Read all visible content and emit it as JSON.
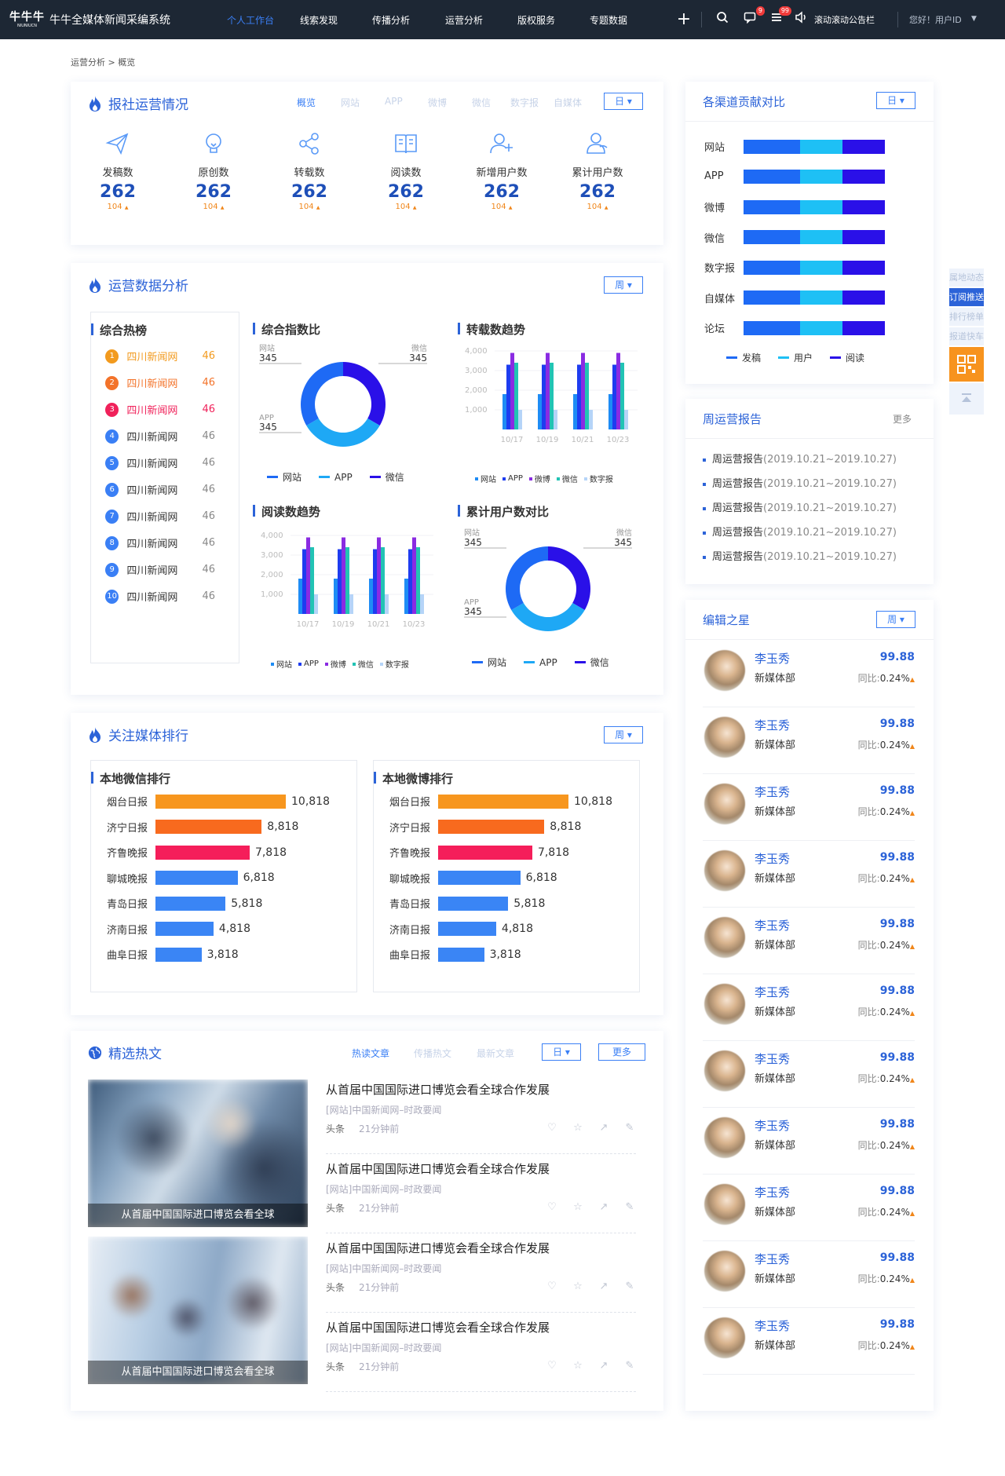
{
  "app": {
    "title": "牛牛全媒体新闻采编系统",
    "logo_text": "牛牛牛",
    "logo_sub": "NIUNIUCN"
  },
  "nav": [
    "个人工作台",
    "线索发现",
    "传播分析",
    "运营分析",
    "版权服务",
    "专题数据"
  ],
  "topbar": {
    "plus": "+",
    "msg_badge": "9",
    "list_badge": "99",
    "announce": "滚动滚动公告栏",
    "greeting": "您好！用户ID"
  },
  "breadcrumb": "运营分析 > 概览",
  "ops": {
    "title": "报社运营情况",
    "tabs": [
      "概览",
      "网站",
      "APP",
      "微博",
      "微信",
      "数字报",
      "自媒体"
    ],
    "period": "日",
    "stats": [
      {
        "label": "发稿数",
        "value": "262",
        "sub": "104",
        "icon": "send-icon"
      },
      {
        "label": "原创数",
        "value": "262",
        "sub": "104",
        "icon": "bulb-icon"
      },
      {
        "label": "转载数",
        "value": "262",
        "sub": "104",
        "icon": "share-icon"
      },
      {
        "label": "阅读数",
        "value": "262",
        "sub": "104",
        "icon": "book-icon"
      },
      {
        "label": "新增用户数",
        "value": "262",
        "sub": "104",
        "icon": "user-add-icon"
      },
      {
        "label": "累计用户数",
        "value": "262",
        "sub": "104",
        "icon": "users-icon"
      }
    ],
    "up_arrow": "▲"
  },
  "analysis": {
    "title": "运营数据分析",
    "period": "周",
    "hot_title": "综合热榜",
    "hot": [
      {
        "rank": "1",
        "name": "四川新闻网",
        "value": "46",
        "color": "#f29a1e"
      },
      {
        "rank": "2",
        "name": "四川新闻网",
        "value": "46",
        "color": "#f3732a"
      },
      {
        "rank": "3",
        "name": "四川新闻网",
        "value": "46",
        "color": "#f0215a"
      },
      {
        "rank": "4",
        "name": "四川新闻网",
        "value": "46",
        "color": "#3a7ff5"
      },
      {
        "rank": "5",
        "name": "四川新闻网",
        "value": "46",
        "color": "#3a7ff5"
      },
      {
        "rank": "6",
        "name": "四川新闻网",
        "value": "46",
        "color": "#3a7ff5"
      },
      {
        "rank": "7",
        "name": "四川新闻网",
        "value": "46",
        "color": "#3a7ff5"
      },
      {
        "rank": "8",
        "name": "四川新闻网",
        "value": "46",
        "color": "#3a7ff5"
      },
      {
        "rank": "9",
        "name": "四川新闻网",
        "value": "46",
        "color": "#3a7ff5"
      },
      {
        "rank": "10",
        "name": "四川新闻网",
        "value": "46",
        "color": "#3a7ff5"
      }
    ],
    "donut1_title": "综合指数比",
    "bar1_title": "转载数趋势",
    "bar2_title": "阅读数趋势",
    "donut2_title": "累计用户数对比",
    "donut_legend": [
      "网站",
      "APP",
      "微信"
    ],
    "bar_legend": [
      "网站",
      "APP",
      "微博",
      "微信",
      "数字报"
    ]
  },
  "chart_data": [
    {
      "type": "pie",
      "title": "综合指数比",
      "labels": [
        "网站",
        "APP",
        "微信"
      ],
      "values": [
        345,
        345,
        345
      ],
      "colors": [
        "#1e6af5",
        "#1ea8f5",
        "#2a10e8"
      ]
    },
    {
      "type": "bar",
      "title": "转载数趋势",
      "categories": [
        "10/17",
        "10/19",
        "10/21",
        "10/23"
      ],
      "yticks": [
        "4,000",
        "3,000",
        "2,000",
        "1,000"
      ],
      "ylim": [
        0,
        4000
      ],
      "series": [
        {
          "name": "网站",
          "color": "#1e8cf5",
          "values": [
            1800,
            1800,
            1800,
            1800
          ]
        },
        {
          "name": "APP",
          "color": "#1e3cf0",
          "values": [
            3300,
            3300,
            3300,
            3300
          ]
        },
        {
          "name": "微博",
          "color": "#8a2be2",
          "values": [
            3900,
            3900,
            3900,
            3900
          ]
        },
        {
          "name": "微信",
          "color": "#22c3b4",
          "values": [
            3400,
            3400,
            3400,
            3400
          ]
        },
        {
          "name": "数字报",
          "color": "#b5d4f8",
          "values": [
            1000,
            1000,
            1000,
            1000
          ]
        }
      ]
    },
    {
      "type": "bar",
      "title": "阅读数趋势",
      "categories": [
        "10/17",
        "10/19",
        "10/21",
        "10/23"
      ],
      "yticks": [
        "4,000",
        "3,000",
        "2,000",
        "1,000"
      ],
      "ylim": [
        0,
        4000
      ],
      "series": [
        {
          "name": "网站",
          "color": "#1e8cf5",
          "values": [
            1800,
            1800,
            1800,
            1800
          ]
        },
        {
          "name": "APP",
          "color": "#1e3cf0",
          "values": [
            3300,
            3300,
            3300,
            3300
          ]
        },
        {
          "name": "微博",
          "color": "#8a2be2",
          "values": [
            3900,
            3900,
            3900,
            3900
          ]
        },
        {
          "name": "微信",
          "color": "#22c3b4",
          "values": [
            3400,
            3400,
            3400,
            3400
          ]
        },
        {
          "name": "数字报",
          "color": "#b5d4f8",
          "values": [
            1000,
            1000,
            1000,
            1000
          ]
        }
      ]
    },
    {
      "type": "pie",
      "title": "累计用户数对比",
      "labels": [
        "网站",
        "APP",
        "微信"
      ],
      "values": [
        345,
        345,
        345
      ],
      "colors": [
        "#1e6af5",
        "#1ea8f5",
        "#2a10e8"
      ]
    },
    {
      "type": "bar",
      "title": "本地微信排行",
      "categories": [
        "烟台日报",
        "济宁日报",
        "齐鲁晚报",
        "聊城晚报",
        "青岛日报",
        "济南日报",
        "曲阜日报"
      ],
      "values": [
        10818,
        8818,
        7818,
        6818,
        5818,
        4818,
        3818
      ],
      "labels": [
        "10,818",
        "8,818",
        "7,818",
        "6,818",
        "5,818",
        "4,818",
        "3,818"
      ]
    },
    {
      "type": "bar",
      "title": "本地微博排行",
      "categories": [
        "烟台日报",
        "济宁日报",
        "齐鲁晚报",
        "聊城晚报",
        "青岛日报",
        "济南日报",
        "曲阜日报"
      ],
      "values": [
        10818,
        8818,
        7818,
        6818,
        5818,
        4818,
        3818
      ],
      "labels": [
        "10,818",
        "8,818",
        "7,818",
        "6,818",
        "5,818",
        "4,818",
        "3,818"
      ]
    },
    {
      "type": "bar",
      "title": "各渠道贡献对比",
      "categories": [
        "网站",
        "APP",
        "微博",
        "微信",
        "数字报",
        "自媒体",
        "论坛"
      ],
      "series": [
        {
          "name": "发稿",
          "color": "#1e6af5",
          "values": [
            40,
            40,
            40,
            40,
            40,
            40,
            40
          ]
        },
        {
          "name": "用户",
          "color": "#1ec0f5",
          "values": [
            30,
            30,
            30,
            30,
            30,
            30,
            30
          ]
        },
        {
          "name": "阅读",
          "color": "#2a10e8",
          "values": [
            30,
            30,
            30,
            30,
            30,
            30,
            30
          ]
        }
      ]
    }
  ],
  "media": {
    "title": "关注媒体排行",
    "period": "周",
    "wechat_title": "本地微信排行",
    "weibo_title": "本地微博排行",
    "bar_colors": [
      "#f7961e",
      "#f86a1e",
      "#f51e5a",
      "#3a85f5",
      "#3a85f5",
      "#3a85f5",
      "#3a85f5"
    ]
  },
  "hot": {
    "title": "精选热文",
    "tabs": [
      "热读文章",
      "传播热文",
      "最新文章"
    ],
    "period": "日",
    "more": "更多",
    "images": [
      {
        "caption": "从首届中国国际进口博览会看全球"
      },
      {
        "caption": "从首届中国国际进口博览会看全球"
      }
    ],
    "items": [
      {
        "title": "从首届中国国际进口博览会看全球合作发展",
        "source": "[网站]中国新闻网–时政要闻",
        "tag": "头条",
        "time": "21分钟前"
      },
      {
        "title": "从首届中国国际进口博览会看全球合作发展",
        "source": "[网站]中国新闻网–时政要闻",
        "tag": "头条",
        "time": "21分钟前"
      },
      {
        "title": "从首届中国国际进口博览会看全球合作发展",
        "source": "[网站]中国新闻网–时政要闻",
        "tag": "头条",
        "time": "21分钟前"
      },
      {
        "title": "从首届中国国际进口博览会看全球合作发展",
        "source": "[网站]中国新闻网–时政要闻",
        "tag": "头条",
        "time": "21分钟前"
      }
    ]
  },
  "channels": {
    "title": "各渠道贡献对比",
    "period": "日",
    "legend": [
      "发稿",
      "用户",
      "阅读"
    ]
  },
  "weekly": {
    "title": "周运营报告",
    "more": "更多",
    "items": [
      {
        "label": "周运营报告",
        "range": "(2019.10.21~2019.10.27)"
      },
      {
        "label": "周运营报告",
        "range": "(2019.10.21~2019.10.27)"
      },
      {
        "label": "周运营报告",
        "range": "(2019.10.21~2019.10.27)"
      },
      {
        "label": "周运营报告",
        "range": "(2019.10.21~2019.10.27)"
      },
      {
        "label": "周运营报告",
        "range": "(2019.10.21~2019.10.27)"
      }
    ]
  },
  "stars": {
    "title": "编辑之星",
    "period": "周",
    "yoy_label": "同比:",
    "items": [
      {
        "name": "李玉秀",
        "dept": "新媒体部",
        "score": "99.88",
        "yoy": "0.24%"
      },
      {
        "name": "李玉秀",
        "dept": "新媒体部",
        "score": "99.88",
        "yoy": "0.24%"
      },
      {
        "name": "李玉秀",
        "dept": "新媒体部",
        "score": "99.88",
        "yoy": "0.24%"
      },
      {
        "name": "李玉秀",
        "dept": "新媒体部",
        "score": "99.88",
        "yoy": "0.24%"
      },
      {
        "name": "李玉秀",
        "dept": "新媒体部",
        "score": "99.88",
        "yoy": "0.24%"
      },
      {
        "name": "李玉秀",
        "dept": "新媒体部",
        "score": "99.88",
        "yoy": "0.24%"
      },
      {
        "name": "李玉秀",
        "dept": "新媒体部",
        "score": "99.88",
        "yoy": "0.24%"
      },
      {
        "name": "李玉秀",
        "dept": "新媒体部",
        "score": "99.88",
        "yoy": "0.24%"
      },
      {
        "name": "李玉秀",
        "dept": "新媒体部",
        "score": "99.88",
        "yoy": "0.24%"
      },
      {
        "name": "李玉秀",
        "dept": "新媒体部",
        "score": "99.88",
        "yoy": "0.24%"
      },
      {
        "name": "李玉秀",
        "dept": "新媒体部",
        "score": "99.88",
        "yoy": "0.24%"
      }
    ]
  },
  "sidebar": [
    {
      "label": "属地动态",
      "active": false
    },
    {
      "label": "订阅推送",
      "active": true
    },
    {
      "label": "排行榜单",
      "active": false
    },
    {
      "label": "报道快车",
      "active": false
    }
  ]
}
